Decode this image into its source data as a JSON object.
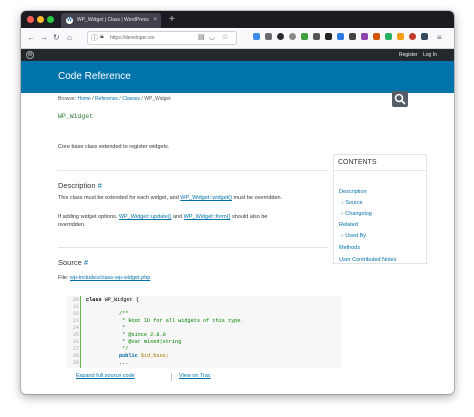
{
  "browser": {
    "tab_title": "WP_Widget | Class | WordPress",
    "tab_close": "×",
    "new_tab": "+",
    "url": "https://developer.wo",
    "nav_back": "←",
    "nav_forward": "→",
    "nav_reload": "↻",
    "nav_home": "⌂"
  },
  "admin_bar": {
    "register": "Register",
    "login": "Log In"
  },
  "header": {
    "title": "Code Reference"
  },
  "breadcrumb": {
    "prefix": "Browse: ",
    "home": "Home",
    "sep": " / ",
    "reference": "Reference",
    "classes": "Classes",
    "current": "WP_Widget"
  },
  "page": {
    "title": "WP_Widget",
    "summary": "Core base class extended to register widgets."
  },
  "description": {
    "heading": "Description",
    "hash": "#",
    "p1_before": "This class must be extended for each widget, and ",
    "p1_link": "WP_Widget::widget()",
    "p1_after": " must be overridden.",
    "p2_before": "If adding widget options, ",
    "p2_link1": "WP_Widget::update()",
    "p2_mid": " and ",
    "p2_link2": "WP_Widget::form()",
    "p2_after": " should also be",
    "p2_line2": "overridden."
  },
  "source": {
    "heading": "Source",
    "hash": "#",
    "file_label": "File: ",
    "file_link": "wp-includes/class-wp-widget.php",
    "line_numbers": [
      "20",
      "21",
      "22",
      "23",
      "24",
      "25",
      "26",
      "27",
      "28",
      "29"
    ],
    "code": {
      "l20_kw": "class",
      "l20_rest": " WP_Widget {",
      "l22": "/**",
      "l23": " * Root ID for all widgets of this type.",
      "l24": " *",
      "l25": " * @since 2.8.0",
      "l26": " * @var mixed|string",
      "l27": " */",
      "l28_kw": "public",
      "l28_rest": " $id_base;",
      "l29": "..."
    },
    "expand_link": "Expand full source code",
    "trac_link": "View on Trac"
  },
  "toc": {
    "heading": "CONTENTS",
    "bullet": "○",
    "items": {
      "description": "Description",
      "source": "Source",
      "changelog": "Changelog",
      "related": "Related",
      "used_by": "Used By",
      "methods": "Methods",
      "user_notes": "User Contributed Notes"
    }
  },
  "colors": {
    "hero": "#0073aa",
    "admin_bar": "#23282d",
    "link": "#0073aa",
    "title_green": "#2d7a3a",
    "code_gutter": "#6ab04c"
  }
}
